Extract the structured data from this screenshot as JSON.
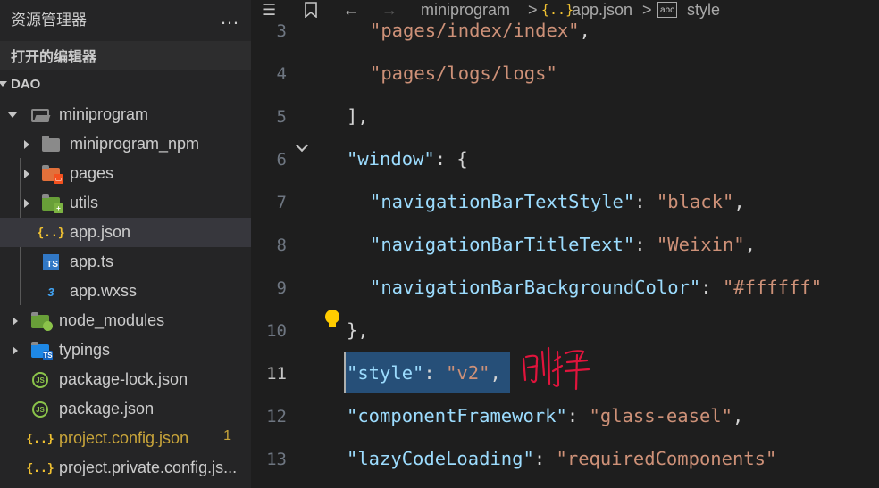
{
  "sidebar": {
    "title": "资源管理器",
    "more_icon": "…",
    "open_editors": "打开的编辑器",
    "root": "DAO",
    "items": [
      {
        "label": "miniprogram",
        "icon": "folder-open-icon"
      },
      {
        "label": "miniprogram_npm",
        "icon": "folder-icon"
      },
      {
        "label": "pages",
        "icon": "folder-pages-icon"
      },
      {
        "label": "utils",
        "icon": "folder-utils-icon"
      },
      {
        "label": "app.json",
        "icon": "json-icon"
      },
      {
        "label": "app.ts",
        "icon": "typescript-icon"
      },
      {
        "label": "app.wxss",
        "icon": "css-icon"
      },
      {
        "label": "node_modules",
        "icon": "folder-node-icon"
      },
      {
        "label": "typings",
        "icon": "folder-ts-icon"
      },
      {
        "label": "package-lock.json",
        "icon": "nodejs-icon"
      },
      {
        "label": "package.json",
        "icon": "nodejs-icon"
      },
      {
        "label": "project.config.json",
        "icon": "json-icon",
        "badge": "1"
      },
      {
        "label": "project.private.config.js...",
        "icon": "json-icon"
      }
    ],
    "colors": {
      "modified": "#c9a53a",
      "selected_bg": "#37373d"
    }
  },
  "editor": {
    "breadcrumb": {
      "folder": "miniprogram",
      "sep": ">",
      "file": "app.json",
      "json_icon": "{..}",
      "symbol_icon": "abc",
      "symbol": "style"
    },
    "lines": [
      {
        "n": "3",
        "tokens": [
          {
            "t": "\"pages/index/index\"",
            "c": "s"
          },
          {
            "t": ",",
            "c": "p"
          }
        ]
      },
      {
        "n": "4",
        "tokens": [
          {
            "t": "\"pages/logs/logs\"",
            "c": "s"
          }
        ]
      },
      {
        "n": "5",
        "tokens": [
          {
            "t": "],",
            "c": "p"
          }
        ]
      },
      {
        "n": "6",
        "tokens": [
          {
            "t": "\"window\"",
            "c": "k"
          },
          {
            "t": ": {",
            "c": "p"
          }
        ]
      },
      {
        "n": "7",
        "tokens": [
          {
            "t": "\"navigationBarTextStyle\"",
            "c": "k"
          },
          {
            "t": ": ",
            "c": "p"
          },
          {
            "t": "\"black\"",
            "c": "s"
          },
          {
            "t": ",",
            "c": "p"
          }
        ]
      },
      {
        "n": "8",
        "tokens": [
          {
            "t": "\"navigationBarTitleText\"",
            "c": "k"
          },
          {
            "t": ": ",
            "c": "p"
          },
          {
            "t": "\"Weixin\"",
            "c": "s"
          },
          {
            "t": ",",
            "c": "p"
          }
        ]
      },
      {
        "n": "9",
        "tokens": [
          {
            "t": "\"navigationBarBackgroundColor\"",
            "c": "k"
          },
          {
            "t": ": ",
            "c": "p"
          },
          {
            "t": "\"#ffffff\"",
            "c": "s"
          }
        ]
      },
      {
        "n": "10",
        "tokens": [
          {
            "t": "},",
            "c": "p"
          }
        ]
      },
      {
        "n": "11",
        "tokens": [
          {
            "t": "\"style\"",
            "c": "k"
          },
          {
            "t": ": ",
            "c": "p"
          },
          {
            "t": "\"v2\"",
            "c": "s"
          },
          {
            "t": ",",
            "c": "p"
          }
        ]
      },
      {
        "n": "12",
        "tokens": [
          {
            "t": "\"componentFramework\"",
            "c": "k"
          },
          {
            "t": ": ",
            "c": "p"
          },
          {
            "t": "\"glass-easel\"",
            "c": "s"
          },
          {
            "t": ",",
            "c": "p"
          }
        ]
      },
      {
        "n": "13",
        "tokens": [
          {
            "t": "\"lazyCodeLoading\"",
            "c": "k"
          },
          {
            "t": ": ",
            "c": "p"
          },
          {
            "t": "\"requiredComponents\"",
            "c": "s"
          }
        ]
      }
    ],
    "annotation": "删掉",
    "colors": {
      "key": "#9cdcfe",
      "string": "#ce9178",
      "selection": "#264f78",
      "annotation_ink": "#e0143c"
    }
  }
}
